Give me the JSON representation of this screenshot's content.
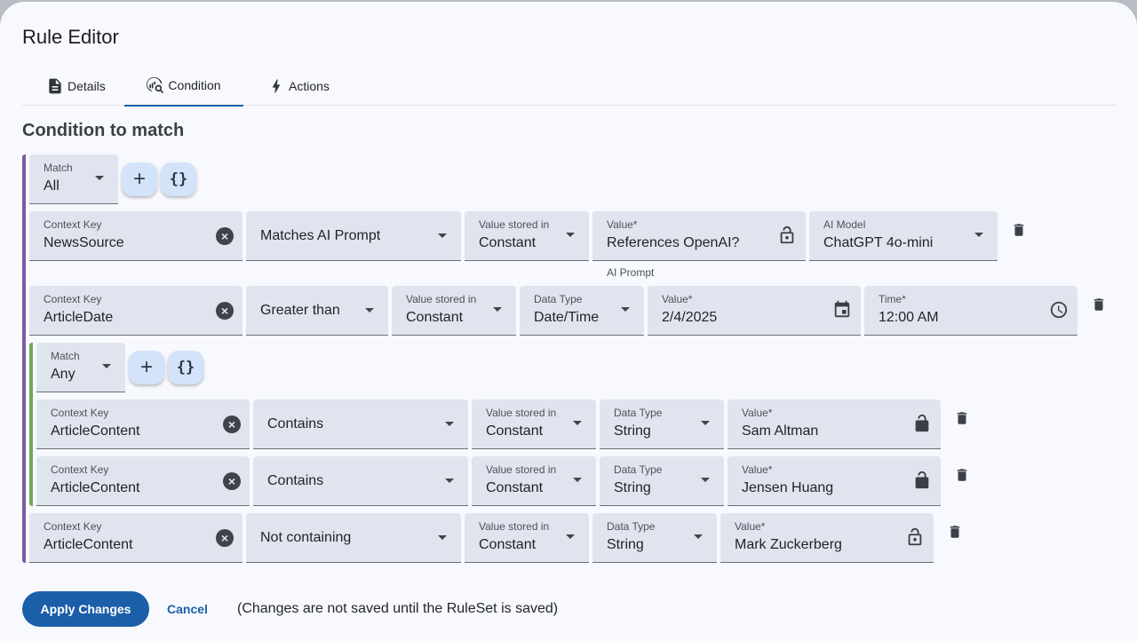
{
  "dialog": {
    "title": "Rule Editor"
  },
  "tabs": [
    {
      "label": "Details",
      "icon": "document-icon"
    },
    {
      "label": "Condition",
      "icon": "query-stats-icon",
      "active": true
    },
    {
      "label": "Actions",
      "icon": "bolt-icon"
    }
  ],
  "section_title": "Condition to match",
  "colors": {
    "accent": "#1b5fa8",
    "outer_group_bar": "#7b5aa6",
    "inner_group_bar": "#6fa85a",
    "field_bg": "#dfe4ee"
  },
  "outer_group": {
    "match_label": "Match",
    "match_value": "All"
  },
  "inner_group": {
    "match_label": "Match",
    "match_value": "Any"
  },
  "rows": {
    "r1": {
      "key_label": "Context Key",
      "key_value": "NewsSource",
      "operator": "Matches AI Prompt",
      "stored_label": "Value stored in",
      "stored_value": "Constant",
      "value_label": "Value*",
      "value_value": "References OpenAI?",
      "value_helper": "AI Prompt",
      "model_label": "AI Model",
      "model_value": "ChatGPT 4o-mini"
    },
    "r2": {
      "key_label": "Context Key",
      "key_value": "ArticleDate",
      "operator": "Greater than",
      "stored_label": "Value stored in",
      "stored_value": "Constant",
      "type_label": "Data Type",
      "type_value": "Date/Time",
      "value_label": "Value*",
      "value_value": "2/4/2025",
      "time_label": "Time*",
      "time_value": "12:00 AM"
    },
    "r3": {
      "key_label": "Context Key",
      "key_value": "ArticleContent",
      "operator": "Contains",
      "stored_label": "Value stored in",
      "stored_value": "Constant",
      "type_label": "Data Type",
      "type_value": "String",
      "value_label": "Value*",
      "value_value": "Sam Altman"
    },
    "r4": {
      "key_label": "Context Key",
      "key_value": "ArticleContent",
      "operator": "Contains",
      "stored_label": "Value stored in",
      "stored_value": "Constant",
      "type_label": "Data Type",
      "type_value": "String",
      "value_label": "Value*",
      "value_value": "Jensen Huang"
    },
    "r5": {
      "key_label": "Context Key",
      "key_value": "ArticleContent",
      "operator": "Not containing",
      "stored_label": "Value stored in",
      "stored_value": "Constant",
      "type_label": "Data Type",
      "type_value": "String",
      "value_label": "Value*",
      "value_value": "Mark Zuckerberg"
    }
  },
  "footer": {
    "apply_label": "Apply Changes",
    "cancel_label": "Cancel",
    "note": "(Changes are not saved until the RuleSet is saved)"
  }
}
